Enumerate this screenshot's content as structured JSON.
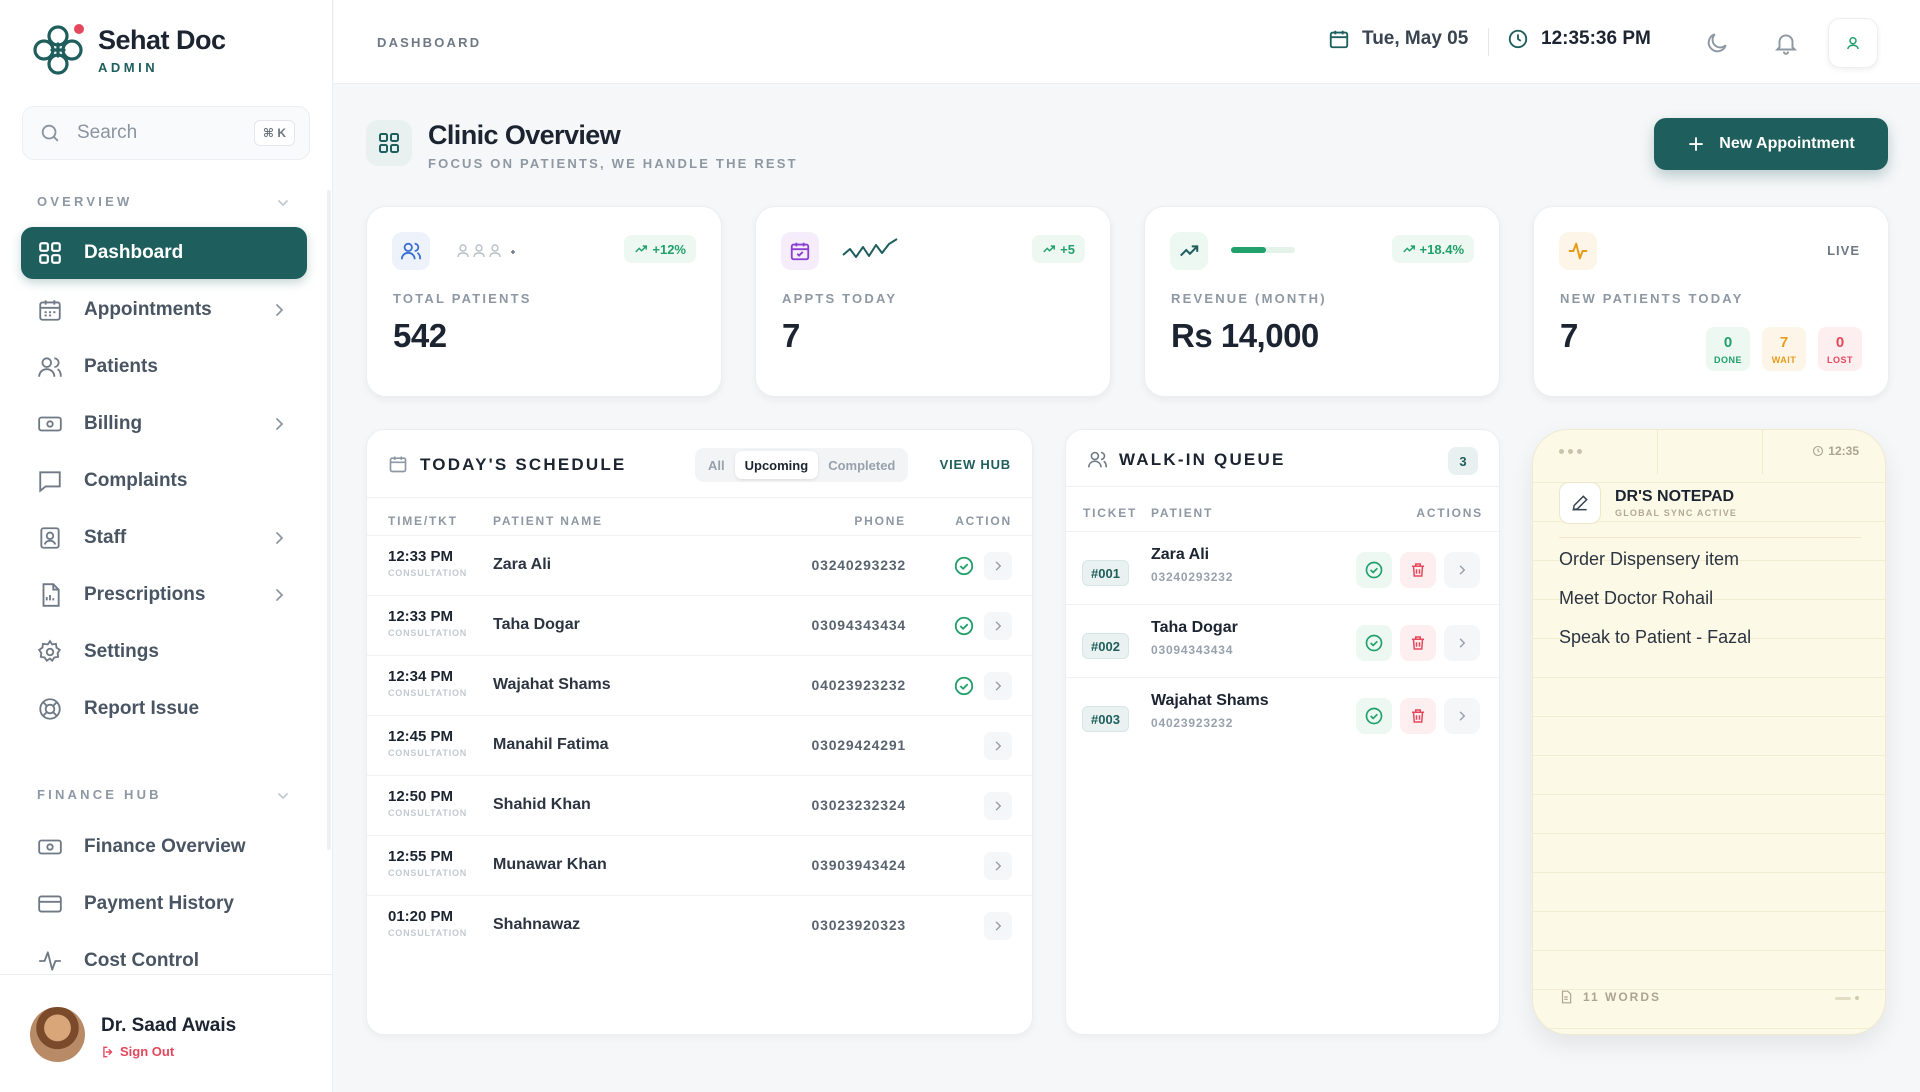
{
  "brand": {
    "name": "Sehat Doc",
    "role": "ADMIN"
  },
  "search": {
    "placeholder": "Search",
    "shortcut": "⌘ K"
  },
  "sidebar": {
    "overview_label": "OVERVIEW",
    "finance_label": "FINANCE HUB",
    "items": [
      {
        "label": "Dashboard",
        "icon": "grid-icon",
        "active": true
      },
      {
        "label": "Appointments",
        "icon": "calendar-icon",
        "has_children": true
      },
      {
        "label": "Patients",
        "icon": "users-icon"
      },
      {
        "label": "Billing",
        "icon": "billing-icon",
        "has_children": true
      },
      {
        "label": "Complaints",
        "icon": "message-icon"
      },
      {
        "label": "Staff",
        "icon": "id-badge-icon",
        "has_children": true
      },
      {
        "label": "Prescriptions",
        "icon": "document-icon",
        "has_children": true
      },
      {
        "label": "Settings",
        "icon": "gear-icon"
      },
      {
        "label": "Report Issue",
        "icon": "lifebuoy-icon"
      }
    ],
    "finance_items": [
      {
        "label": "Finance Overview",
        "icon": "cash-icon"
      },
      {
        "label": "Payment History",
        "icon": "credit-card-icon"
      },
      {
        "label": "Cost Control",
        "icon": "activity-icon"
      }
    ]
  },
  "user": {
    "name": "Dr. Saad Awais",
    "signout": "Sign Out"
  },
  "topbar": {
    "breadcrumb": "DASHBOARD",
    "date": "Tue, May 05",
    "time": "12:35:36 PM"
  },
  "header": {
    "title": "Clinic Overview",
    "subtitle": "FOCUS ON PATIENTS, WE HANDLE THE REST",
    "new_button": "New Appointment"
  },
  "stats": {
    "patients": {
      "label": "TOTAL PATIENTS",
      "value": "542",
      "badge": "+12%"
    },
    "appts": {
      "label": "APPTS TODAY",
      "value": "7",
      "badge": "+5"
    },
    "revenue": {
      "label": "REVENUE (MONTH)",
      "value": "Rs 14,000",
      "badge": "+18.4%",
      "progress": 0.55
    },
    "new_patients": {
      "label": "NEW PATIENTS TODAY",
      "value": "7",
      "live": "LIVE",
      "done": {
        "n": "0",
        "l": "DONE"
      },
      "wait": {
        "n": "7",
        "l": "WAIT"
      },
      "lost": {
        "n": "0",
        "l": "LOST"
      }
    }
  },
  "schedule": {
    "title": "TODAY'S SCHEDULE",
    "filters": [
      "All",
      "Upcoming",
      "Completed"
    ],
    "active_filter": "Upcoming",
    "view_hub": "VIEW HUB",
    "columns": [
      "TIME/TKT",
      "PATIENT NAME",
      "PHONE",
      "ACTION"
    ],
    "rows": [
      {
        "time": "12:33 PM",
        "type": "CONSULTATION",
        "name": "Zara Ali",
        "phone": "03240293232",
        "checked": true
      },
      {
        "time": "12:33 PM",
        "type": "CONSULTATION",
        "name": "Taha Dogar",
        "phone": "03094343434",
        "checked": true
      },
      {
        "time": "12:34 PM",
        "type": "CONSULTATION",
        "name": "Wajahat Shams",
        "phone": "04023923232",
        "checked": true
      },
      {
        "time": "12:45 PM",
        "type": "CONSULTATION",
        "name": "Manahil Fatima",
        "phone": "03029424291",
        "checked": false
      },
      {
        "time": "12:50 PM",
        "type": "CONSULTATION",
        "name": "Shahid Khan",
        "phone": "03023232324",
        "checked": false
      },
      {
        "time": "12:55 PM",
        "type": "CONSULTATION",
        "name": "Munawar Khan",
        "phone": "03903943424",
        "checked": false
      },
      {
        "time": "01:20 PM",
        "type": "CONSULTATION",
        "name": "Shahnawaz",
        "phone": "03023920323",
        "checked": false
      }
    ]
  },
  "queue": {
    "title": "WALK-IN QUEUE",
    "count": "3",
    "columns": [
      "TICKET",
      "PATIENT",
      "ACTIONS"
    ],
    "rows": [
      {
        "ticket": "#001",
        "name": "Zara Ali",
        "phone": "03240293232"
      },
      {
        "ticket": "#002",
        "name": "Taha Dogar",
        "phone": "03094343434"
      },
      {
        "ticket": "#003",
        "name": "Wajahat Shams",
        "phone": "04023923232"
      }
    ]
  },
  "notepad": {
    "time": "12:35",
    "title": "DR'S NOTEPAD",
    "subtitle": "GLOBAL SYNC ACTIVE",
    "lines": [
      "Order Dispensery item",
      "Meet Doctor Rohail",
      "Speak to Patient - Fazal"
    ],
    "word_count": "11 WORDS"
  },
  "colors": {
    "primary": "#1e5e5c",
    "success": "#22a06b",
    "danger": "#e5485d",
    "warning": "#e69c1a",
    "purple": "#8b3fd1"
  }
}
